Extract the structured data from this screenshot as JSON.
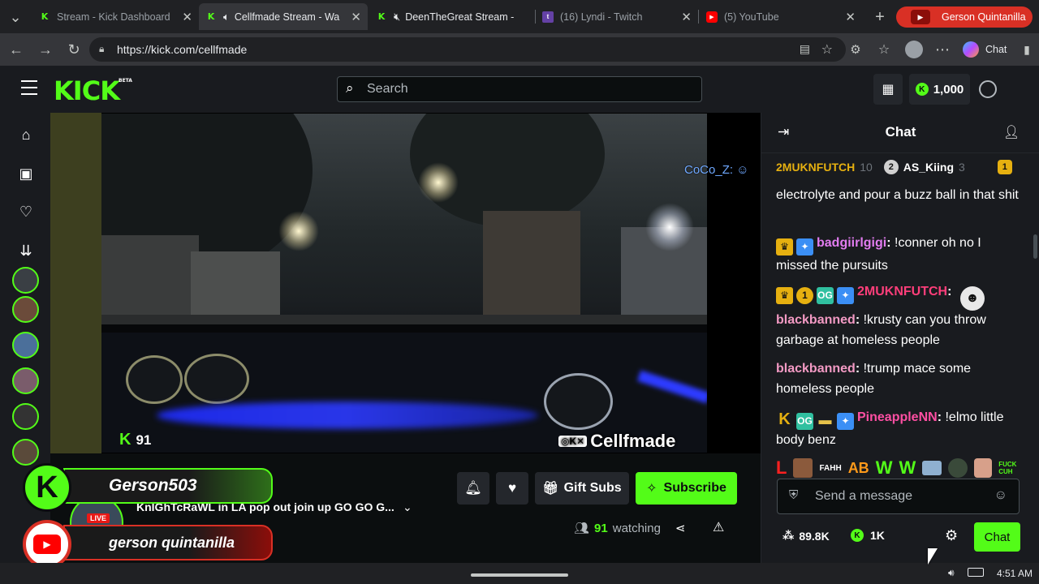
{
  "browser": {
    "tabs": [
      {
        "title": "Stream - Kick Dashboard",
        "favicon": "kick"
      },
      {
        "title": "Cellfmade Stream - Wa",
        "favicon": "kick"
      },
      {
        "title": "DeenTheGreat Stream -",
        "favicon": "kick"
      },
      {
        "title": "(16) Lyndi - Twitch",
        "favicon": "twitch"
      },
      {
        "title": "(5) YouTube",
        "favicon": "youtube"
      }
    ],
    "profile_name": "Gerson Quintanilla",
    "url": "https://kick.com/cellfmade",
    "copilot_label": "Chat"
  },
  "kick": {
    "logo_text": "KICK",
    "beta": "BETA",
    "search_placeholder": "Search",
    "coins": "1,000"
  },
  "player": {
    "viewer_badge": "91",
    "watermark": "Cellfmade",
    "top_right_name": "CoCo_Z:"
  },
  "overlay": {
    "kick_name": "Gerson503",
    "yt_name": "gerson quintanilla",
    "live": "LIVE"
  },
  "stream": {
    "title": "KnIGhTcRaWL in LA pop out join up GO GO G...",
    "gift_subs": "Gift Subs",
    "subscribe": "Subscribe",
    "watching_count": "91",
    "watching_label": "watching"
  },
  "chat": {
    "header": "Chat",
    "pinned": [
      {
        "user": "2MUKNFUTCH",
        "count": "10",
        "color": "#e6b010"
      },
      {
        "user": "AS_Kiing",
        "count": "3",
        "color": "#ffffff"
      }
    ],
    "messages": [
      {
        "user": "",
        "text": "electrolyte and pour a buzz ball in that shit",
        "color": "#ffffff"
      },
      {
        "user": "badgiirlgigi",
        "text": "!conner oh no I missed the pursuits",
        "color": "#e27cf0"
      },
      {
        "user": "2MUKNFUTCH",
        "text": "",
        "color": "#ff3e7a"
      },
      {
        "user": "blackbanned",
        "text": "!krusty can you throw garbage at homeless people",
        "color": "#f39ac4"
      },
      {
        "user": "blackbanned",
        "text": "!trump mace some homeless people",
        "color": "#f39ac4"
      },
      {
        "user": "PineappleNN",
        "text": "!elmo little body benz",
        "color": "#ff4fa3"
      }
    ],
    "emotes": [
      "L",
      "FAHH",
      "AB",
      "W",
      "W",
      "FUCK CUH"
    ],
    "input_placeholder": "Send a message",
    "followers": "89.8K",
    "coins": "1K",
    "chat_button": "Chat"
  },
  "taskbar": {
    "time": "4:51 AM"
  },
  "colors": {
    "kick_green": "#53fc18",
    "bg": "#0b0e0f",
    "panel": "#191b1f"
  }
}
